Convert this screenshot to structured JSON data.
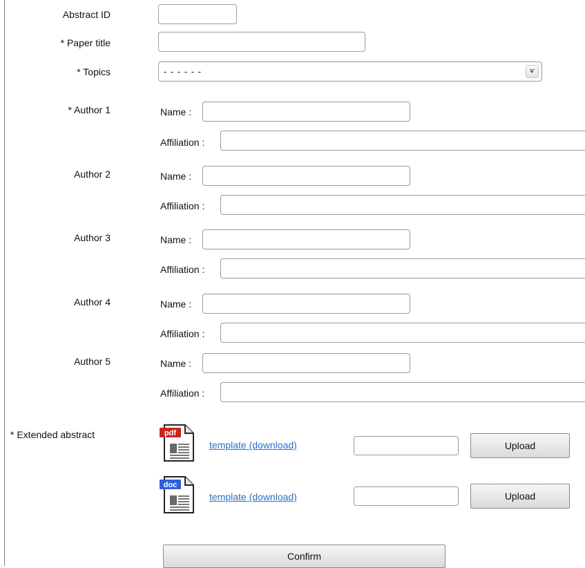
{
  "form": {
    "abstract_id": {
      "label": "Abstract ID",
      "value": ""
    },
    "paper_title": {
      "label": "* Paper title",
      "value": ""
    },
    "topics": {
      "label": "* Topics",
      "selected": "- - - - - -"
    },
    "name_label": "Name :",
    "affiliation_label": "Affiliation :",
    "authors": [
      {
        "label": "* Author 1",
        "name": "",
        "affiliation": ""
      },
      {
        "label": "Author 2",
        "name": "",
        "affiliation": ""
      },
      {
        "label": "Author 3",
        "name": "",
        "affiliation": ""
      },
      {
        "label": "Author 4",
        "name": "",
        "affiliation": ""
      },
      {
        "label": "Author 5",
        "name": "",
        "affiliation": ""
      }
    ],
    "extended_abstract": {
      "label": "* Extended abstract",
      "files": [
        {
          "type": "pdf",
          "icon": "pdf-file-icon",
          "badge": "pdf",
          "badge_color": "#c8251d",
          "link": "template (download)",
          "upload_label": "Upload",
          "value": ""
        },
        {
          "type": "doc",
          "icon": "doc-file-icon",
          "badge": "doc",
          "badge_color": "#2f5fd6",
          "link": "template (download)",
          "upload_label": "Upload",
          "value": ""
        }
      ]
    },
    "confirm_label": "Confirm"
  },
  "colors": {
    "link": "#2a6fc9",
    "border": "#9a9a9a"
  }
}
